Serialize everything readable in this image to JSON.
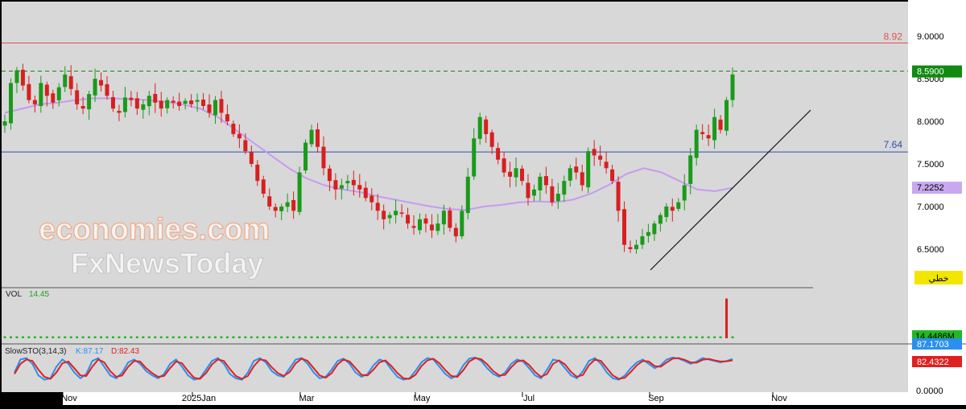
{
  "watermark": {
    "line1": "economies.com",
    "line2": "FxNewsToday"
  },
  "colors": {
    "plot_bg": "#d8d8d8",
    "axis_bg": "#ffffff",
    "up": "#1a9a1a",
    "down": "#d62020",
    "ma": "#c79bf0",
    "resistance": "#e05050",
    "support": "#2850b0",
    "stoch_k": "#2a8ff0",
    "stoch_d": "#e02020",
    "vol_bar": "#22b822"
  },
  "chart_data": {
    "type": "candlestick",
    "x_ticks": [
      "Nov",
      "2025Jan",
      "Mar",
      "May",
      "Jul",
      "Sep",
      "Nov"
    ],
    "y_ticks": [
      "9.0000",
      "8.5000",
      "8.0000",
      "7.5000",
      "7.0000",
      "6.5000"
    ],
    "ylim": [
      6.05,
      9.35
    ],
    "price_series": [
      8.0,
      8.45,
      8.6,
      8.42,
      8.25,
      8.2,
      8.45,
      8.3,
      8.22,
      8.4,
      8.55,
      8.38,
      8.2,
      8.15,
      8.32,
      8.5,
      8.42,
      8.3,
      8.15,
      8.1,
      8.28,
      8.25,
      8.15,
      8.2,
      8.3,
      8.22,
      8.15,
      8.25,
      8.22,
      8.18,
      8.24,
      8.2,
      8.25,
      8.18,
      8.1,
      8.25,
      8.1,
      8.0,
      7.85,
      7.8,
      7.65,
      7.5,
      7.3,
      7.15,
      7.0,
      6.95,
      7.0,
      7.05,
      6.95,
      7.4,
      7.75,
      7.9,
      7.7,
      7.45,
      7.3,
      7.2,
      7.25,
      7.3,
      7.25,
      7.2,
      7.1,
      7.05,
      6.95,
      6.85,
      6.9,
      6.95,
      6.92,
      6.8,
      6.75,
      6.85,
      6.8,
      6.72,
      6.8,
      6.95,
      6.75,
      6.65,
      6.95,
      7.35,
      7.8,
      8.05,
      7.85,
      7.7,
      7.55,
      7.4,
      7.35,
      7.45,
      7.3,
      7.1,
      7.2,
      7.35,
      7.25,
      7.05,
      7.15,
      7.3,
      7.45,
      7.4,
      7.25,
      7.65,
      7.6,
      7.55,
      7.45,
      7.3,
      6.95,
      6.55,
      6.5,
      6.55,
      6.65,
      6.7,
      6.8,
      6.9,
      7.0,
      6.95,
      7.05,
      7.25,
      7.6,
      7.9,
      7.85,
      7.8,
      8.05,
      7.9,
      8.25,
      8.55
    ],
    "ma_series": [
      8.1,
      8.15,
      8.2,
      8.22,
      8.25,
      8.27,
      8.27,
      8.26,
      8.25,
      8.23,
      8.2,
      8.15,
      8.05,
      7.9,
      7.75,
      7.6,
      7.45,
      7.33,
      7.25,
      7.2,
      7.17,
      7.12,
      7.08,
      7.04,
      7.0,
      6.97,
      6.96,
      7.0,
      7.02,
      7.05,
      7.06,
      7.05,
      7.08,
      7.15,
      7.25,
      7.38,
      7.45,
      7.4,
      7.3,
      7.2,
      7.18,
      7.22
    ],
    "resistance": {
      "value": 8.92,
      "label": "8.92"
    },
    "support": {
      "value": 7.64,
      "label": "7.64"
    },
    "current_price": {
      "value": 8.59,
      "label": "8.5900"
    },
    "ma_value": {
      "value": 7.2252,
      "label": "7.2252"
    },
    "arabic_tag": "خطي",
    "volume": {
      "label": "VOL",
      "value": "14.45",
      "axis_label": "14.4486M",
      "spike_index": 120,
      "spike_fraction": 0.9
    },
    "stochastic": {
      "label": "SlowSTO(3,14,3)",
      "k_label": "K:87.17",
      "d_label": "D:82.43",
      "k_value": "87.1703",
      "d_value": "82.4322",
      "zero_label": "0.0000",
      "k_series": [
        40,
        85,
        90,
        70,
        30,
        15,
        20,
        60,
        85,
        70,
        40,
        20,
        35,
        80,
        90,
        60,
        30,
        20,
        40,
        75,
        85,
        70,
        45,
        30,
        20,
        35,
        70,
        85,
        60,
        30,
        15,
        20,
        50,
        80,
        90,
        70,
        35,
        20,
        15,
        40,
        80,
        90,
        75,
        45,
        30,
        25,
        55,
        85,
        90,
        70,
        40,
        20,
        25,
        50,
        80,
        88,
        70,
        40,
        25,
        35,
        65,
        85,
        78,
        50,
        25,
        15,
        20,
        45,
        75,
        90,
        85,
        60,
        35,
        20,
        30,
        65,
        88,
        92,
        80,
        55,
        35,
        25,
        40,
        70,
        85,
        78,
        55,
        30,
        20,
        50,
        85,
        80,
        55,
        30,
        20,
        45,
        80,
        90,
        70,
        40,
        20,
        15,
        30,
        55,
        75,
        85,
        70,
        55,
        65,
        85,
        92,
        88,
        80,
        70,
        78,
        90,
        85,
        80,
        75,
        80,
        87
      ],
      "d_series": [
        35,
        70,
        85,
        80,
        50,
        25,
        18,
        40,
        72,
        78,
        55,
        30,
        28,
        60,
        85,
        75,
        45,
        25,
        30,
        60,
        80,
        78,
        55,
        38,
        25,
        28,
        55,
        78,
        72,
        45,
        22,
        18,
        38,
        68,
        85,
        80,
        52,
        28,
        18,
        28,
        62,
        85,
        82,
        58,
        38,
        28,
        42,
        72,
        88,
        80,
        55,
        30,
        22,
        38,
        68,
        85,
        78,
        55,
        32,
        30,
        50,
        75,
        82,
        62,
        38,
        20,
        18,
        32,
        62,
        82,
        88,
        72,
        48,
        28,
        25,
        48,
        78,
        90,
        86,
        68,
        45,
        30,
        32,
        58,
        78,
        82,
        66,
        42,
        25,
        35,
        70,
        82,
        68,
        42,
        25,
        32,
        65,
        85,
        80,
        55,
        30,
        18,
        22,
        42,
        65,
        80,
        78,
        62,
        60,
        75,
        88,
        90,
        84,
        75,
        74,
        84,
        87,
        82,
        78,
        79,
        82
      ]
    }
  }
}
